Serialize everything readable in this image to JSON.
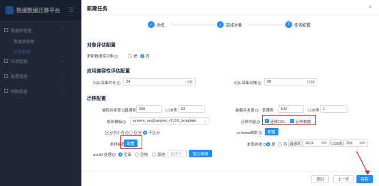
{
  "app": {
    "title": "数据数据迁移平台",
    "sidebar": {
      "items": [
        {
          "label": "数据库管理"
        },
        {
          "label": "应用管理"
        },
        {
          "label": "配置管理"
        },
        {
          "label": "权限管理"
        }
      ],
      "subitems": [
        {
          "label": "数据源管理"
        },
        {
          "label": "迁移管理"
        }
      ]
    }
  },
  "drawer": {
    "title": "新建任务",
    "close": "×",
    "steps": [
      {
        "label": "命名",
        "marker": "✓"
      },
      {
        "label": "选择对象",
        "marker": "✓"
      },
      {
        "label": "任务配置",
        "marker": "3"
      }
    ],
    "section_object": {
      "title": "对象评估配置",
      "update_label": "更新数据库对象",
      "opt_yes": "是",
      "opt_no": "否"
    },
    "section_compat": {
      "title": "应用兼容性评估配置",
      "sql_duration_label": "SQL采集时长",
      "sql_duration_value": "24",
      "sql_duration_unit": "小时",
      "sql_interval_label": "SQL采集间隔",
      "sql_interval_value": "60",
      "sql_interval_unit": "分钟"
    },
    "section_migrate": {
      "title": "迁移配置",
      "extract_label": "抽取并发度",
      "extract_normal_label": "普通表",
      "extract_normal_value": "200",
      "extract_lob_label": "LOB表",
      "extract_lob_value": "30",
      "load_label": "装载并发度",
      "load_normal_label": "普通表",
      "load_normal_value": "100",
      "load_lob_label": "LOB表",
      "load_lob_value": "1",
      "rule_label": "规则模板",
      "rule_value": "system_ora2panwei_v2.0.0_template",
      "content_label": "迁移内容",
      "content_ddl": "迁移DDL",
      "content_data": "迁移数据",
      "case_label": "区分大小写",
      "case_yes": "区分",
      "case_no": "不区分",
      "schema_label": "schema映射",
      "schema_btn": "配置",
      "cond_label": "条件抽取",
      "cond_btn": "配置",
      "single_label": "单表并发",
      "single_yes": "是",
      "single_no": "否",
      "single_normal_label": "普通表",
      "single_normal_value": "1024",
      "single_normal_unit": "MB",
      "single_lob_label": "LOB表",
      "single_lob_value": "256",
      "single_lob_unit": "MB",
      "ascii_label": "ascii0 处理",
      "ascii_opt1": "空串",
      "ascii_opt2": "空格",
      "ascii_opt3": "其他",
      "ascii_placeholder": "替换字",
      "ascii_btn": "独立规则"
    },
    "footer": {
      "cancel": "退出",
      "prev": "上一步",
      "save": "保存"
    }
  },
  "colors": {
    "accent": "#1f8fff",
    "highlight": "#e02424"
  }
}
